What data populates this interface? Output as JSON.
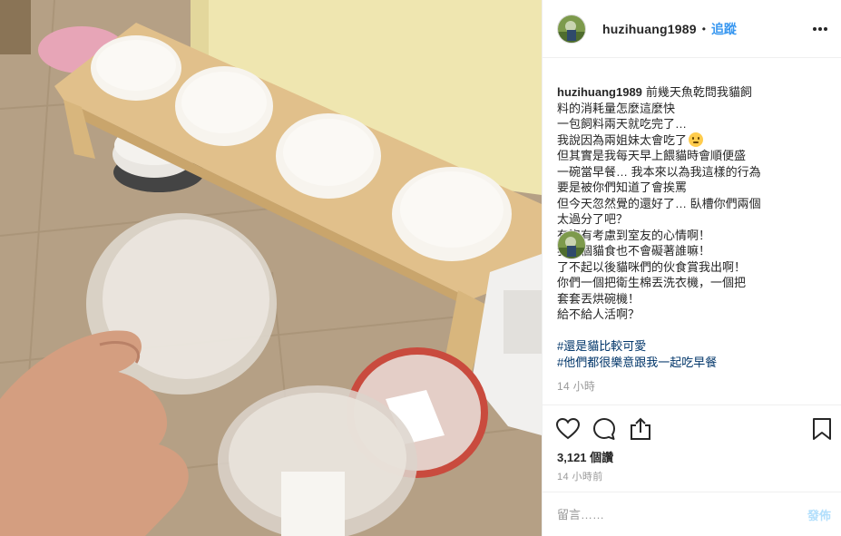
{
  "post": {
    "username": "huzihuang1989",
    "dot": "•",
    "follow_label": "追蹤",
    "caption_lines": [
      "前幾天魚乾問我貓飼",
      "料的消耗量怎麼這麼快",
      "一包飼料兩天就吃完了…",
      "我說因為兩姐妹太會吃了",
      "但其實是我每天早上餵貓時會順便盛",
      "一碗當早餐… 我本來以為我這樣的行為",
      "要是被你們知道了會挨罵",
      "但今天忽然覺的還好了… 臥槽你們兩個",
      "太過分了吧？",
      "有沒有考慮到室友的心情啊！",
      "我吃個貓食也不會礙著誰嘛！",
      "了不起以後貓咪們的伙食賞我出啊！",
      "你們一個把衛生棉丟洗衣機，一個把",
      "套套丟烘碗機！",
      "給不給人活啊？"
    ],
    "hashtags": [
      "#還是貓比較可愛",
      "#他們都很樂意跟我一起吃早餐"
    ],
    "caption_time": "14 小時",
    "views": "3,121 個讚",
    "post_time": "14 小時前",
    "comment_placeholder": "留言……",
    "post_button": "發佈"
  },
  "icons": {
    "more": "more-options-icon",
    "like": "heart-icon",
    "comment": "comment-icon",
    "share": "share-icon",
    "save": "bookmark-icon",
    "emoji": "worried-face-emoji"
  },
  "colors": {
    "link_blue": "#3897f0",
    "hashtag_blue": "#003569",
    "muted_gray": "#999999",
    "post_disabled": "#b2dffc"
  }
}
